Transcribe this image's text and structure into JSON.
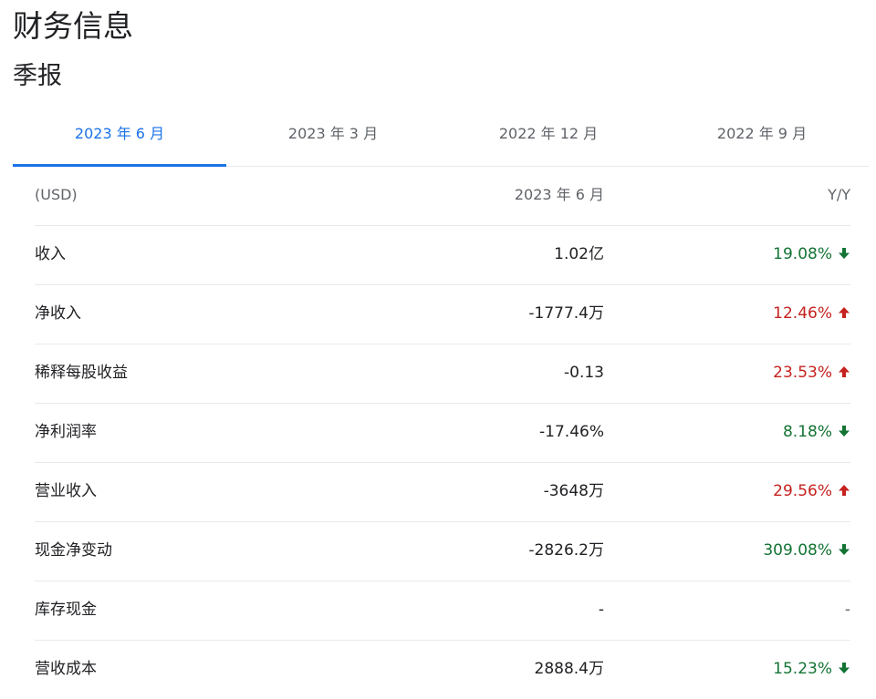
{
  "page_title": "财务信息",
  "section_title": "季报",
  "tabs": [
    {
      "label": "2023 年 6 月",
      "active": true
    },
    {
      "label": "2023 年 3 月",
      "active": false
    },
    {
      "label": "2022 年 12 月",
      "active": false
    },
    {
      "label": "2022 年 9 月",
      "active": false
    }
  ],
  "table": {
    "header": {
      "label": "(USD)",
      "value": "2023 年 6 月",
      "yoy": "Y/Y"
    },
    "rows": [
      {
        "label": "收入",
        "value": "1.02亿",
        "yoy": "19.08%",
        "trend": "down",
        "icon": "arrow-down-icon"
      },
      {
        "label": "净收入",
        "value": "-1777.4万",
        "yoy": "12.46%",
        "trend": "up",
        "icon": "arrow-up-icon"
      },
      {
        "label": "稀释每股收益",
        "value": "-0.13",
        "yoy": "23.53%",
        "trend": "up",
        "icon": "arrow-up-icon"
      },
      {
        "label": "净利润率",
        "value": "-17.46%",
        "yoy": "8.18%",
        "trend": "down",
        "icon": "arrow-down-icon"
      },
      {
        "label": "营业收入",
        "value": "-3648万",
        "yoy": "29.56%",
        "trend": "up",
        "icon": "arrow-up-icon"
      },
      {
        "label": "现金净变动",
        "value": "-2826.2万",
        "yoy": "309.08%",
        "trend": "down",
        "icon": "arrow-down-icon"
      },
      {
        "label": "库存现金",
        "value": "-",
        "yoy": "-",
        "trend": "none",
        "icon": ""
      },
      {
        "label": "营收成本",
        "value": "2888.4万",
        "yoy": "15.23%",
        "trend": "down",
        "icon": "arrow-down-icon"
      }
    ]
  },
  "colors": {
    "accent": "#1a73e8",
    "up": "#c5221f",
    "down": "#137333"
  }
}
